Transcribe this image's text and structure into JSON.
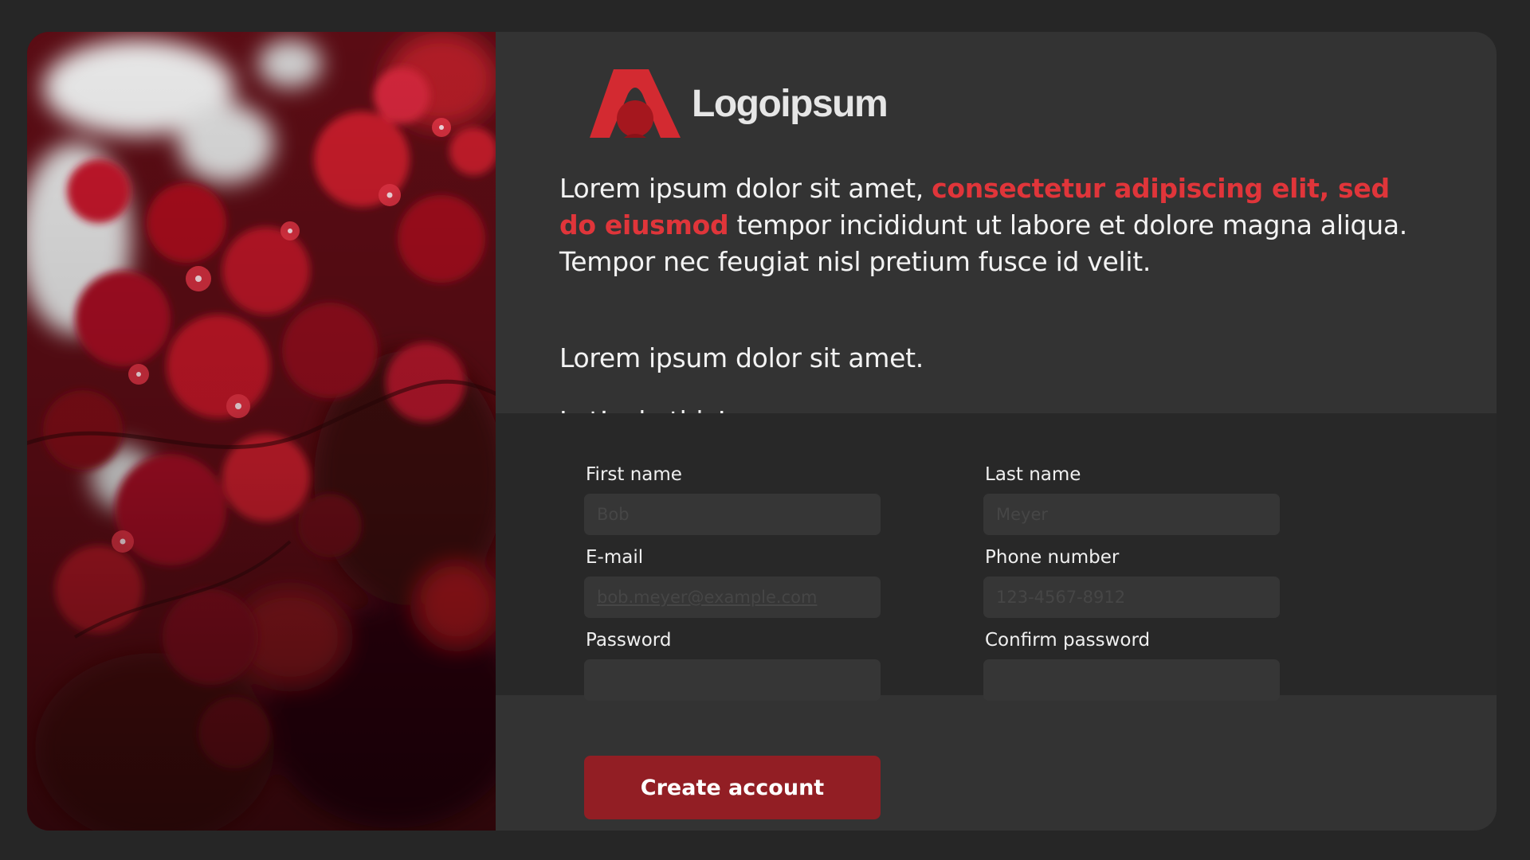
{
  "brand": {
    "logo_text": "Logoipsum",
    "logo_icon": "logo-a-mark",
    "accent_color": "#e0353a"
  },
  "intro": {
    "text_before": "Lorem ipsum dolor sit amet, ",
    "highlight": "consectetur adipiscing elit, sed do eiusmod",
    "text_after": " tempor incididunt ut labore et dolore magna aliqua. Tempor nec feugiat nisl pretium fusce id velit."
  },
  "tagline": "Lorem ipsum dolor sit amet.",
  "cta_text": "Let’s do this!",
  "form": {
    "first_name": {
      "label": "First name",
      "placeholder": "Bob",
      "value": ""
    },
    "last_name": {
      "label": "Last name",
      "placeholder": "Meyer",
      "value": ""
    },
    "email": {
      "label": "E-mail",
      "placeholder": "bob.meyer@example.com",
      "value": ""
    },
    "phone": {
      "label": "Phone number",
      "placeholder": "123-4567-8912",
      "value": ""
    },
    "password": {
      "label": "Password",
      "placeholder": "",
      "value": ""
    },
    "confirm_password": {
      "label": "Confirm password",
      "placeholder": "",
      "value": ""
    }
  },
  "submit": {
    "label": "Create account",
    "color": "#921e24"
  },
  "photo": {
    "subject": "red-bougainvillea-flowers"
  }
}
